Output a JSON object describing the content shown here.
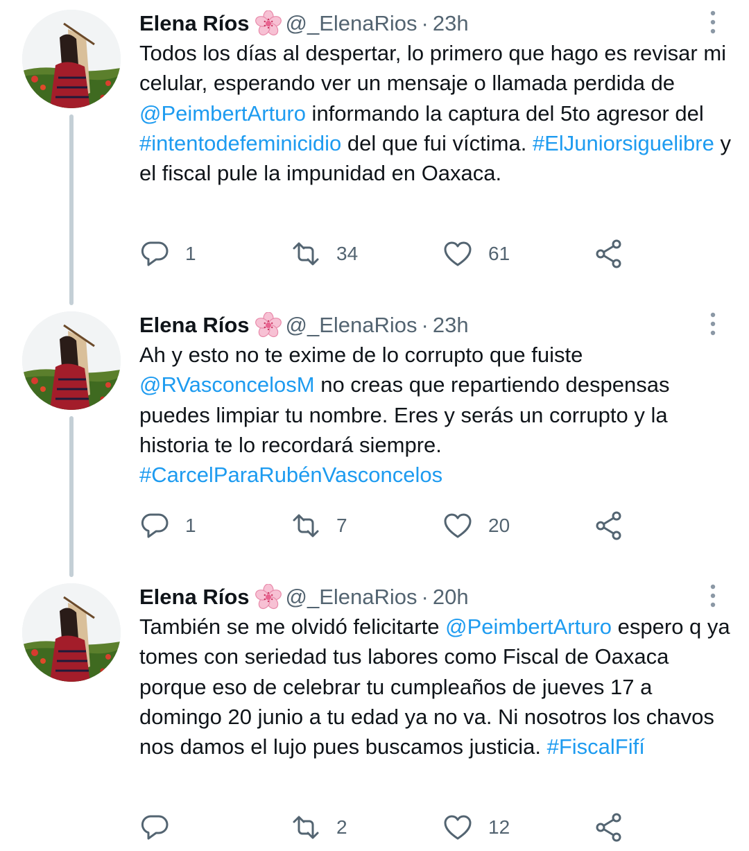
{
  "tweets": [
    {
      "name": "Elena Ríos",
      "handle": "@_ElenaRios",
      "separator": "·",
      "time": "23h",
      "body": [
        {
          "t": "text",
          "v": "Todos los días al despertar, lo primero que hago es revisar mi celular, esperando ver un mensaje o llamada perdida de "
        },
        {
          "t": "mention",
          "v": "@PeimbertArturo"
        },
        {
          "t": "text",
          "v": " informando la captura del 5to agresor del "
        },
        {
          "t": "hashtag",
          "v": "#intentodefeminicidio"
        },
        {
          "t": "text",
          "v": " del que fui víctima. "
        },
        {
          "t": "hashtag",
          "v": "#ElJuniorsiguelibre"
        },
        {
          "t": "text",
          "v": " y el fiscal pule la impunidad en Oaxaca."
        }
      ],
      "replies": "1",
      "retweets": "34",
      "likes": "61"
    },
    {
      "name": "Elena Ríos",
      "handle": "@_ElenaRios",
      "separator": "·",
      "time": "23h",
      "body": [
        {
          "t": "text",
          "v": "Ah y esto no te exime de lo corrupto que fuiste "
        },
        {
          "t": "mention",
          "v": "@RVasconcelosM"
        },
        {
          "t": "text",
          "v": " no creas que repartiendo despensas puedes limpiar tu nombre. Eres y serás un corrupto y la historia te lo recordará siempre. "
        },
        {
          "t": "hashtag",
          "v": "#CarcelParaRubénVasconcelos"
        }
      ],
      "replies": "1",
      "retweets": "7",
      "likes": "20"
    },
    {
      "name": "Elena Ríos",
      "handle": "@_ElenaRios",
      "separator": "·",
      "time": "20h",
      "body": [
        {
          "t": "text",
          "v": "También se me olvidó felicitarte "
        },
        {
          "t": "mention",
          "v": "@PeimbertArturo"
        },
        {
          "t": "text",
          "v": " espero q ya tomes con seriedad tus labores como Fiscal de Oaxaca porque eso de celebrar tu cumpleaños de jueves 17 a domingo 20 junio a tu edad ya no va. Ni nosotros los chavos nos damos el lujo pues buscamos justicia. "
        },
        {
          "t": "hashtag",
          "v": "#FiscalFifí"
        }
      ],
      "replies": "",
      "retweets": "2",
      "likes": "12"
    }
  ],
  "icons": {
    "reply": "reply-icon",
    "retweet": "retweet-icon",
    "like": "heart-icon",
    "share": "share-icon",
    "more": "more-vertical-icon",
    "emoji": "cherry-blossom-icon"
  },
  "colors": {
    "link": "#1d9bf0",
    "muted": "#536471",
    "text": "#0f1419",
    "thread_line": "#c4cfd6"
  }
}
